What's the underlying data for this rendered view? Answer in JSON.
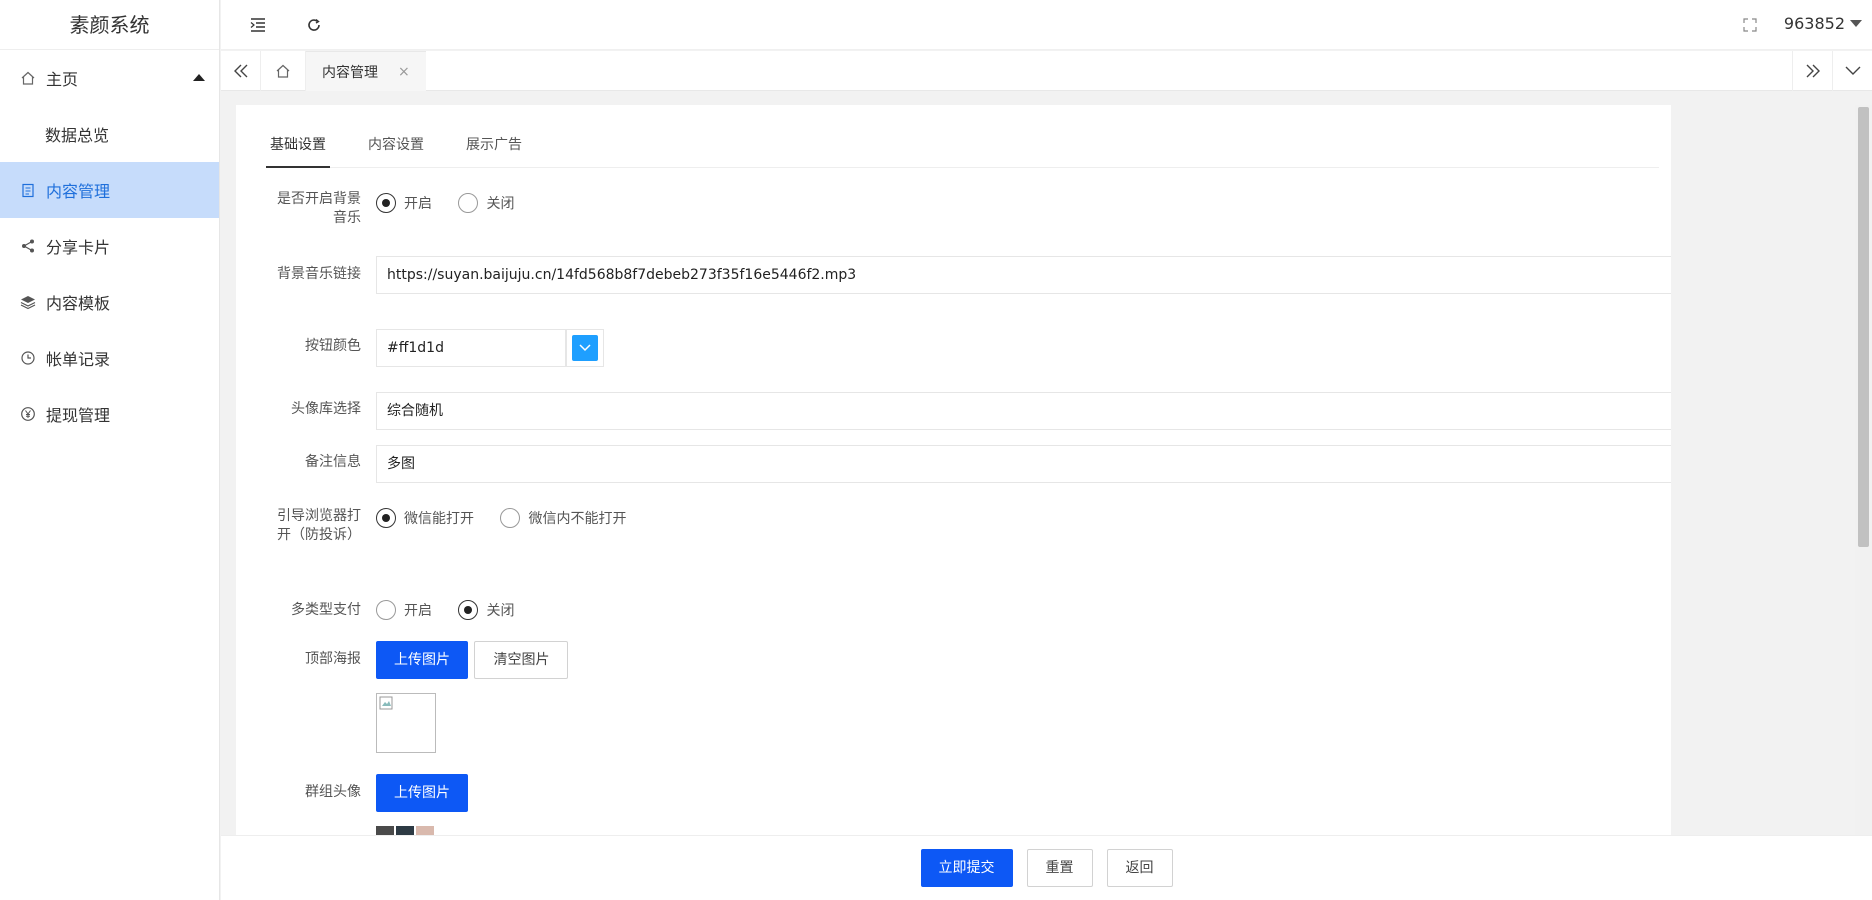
{
  "app": {
    "title": "素颜系统"
  },
  "sidebar": {
    "items": [
      {
        "label": "主页",
        "icon": "home-icon"
      },
      {
        "label": "数据总览"
      },
      {
        "label": "内容管理",
        "icon": "clipboard-icon",
        "active": true
      },
      {
        "label": "分享卡片",
        "icon": "share-icon"
      },
      {
        "label": "内容模板",
        "icon": "layers-icon"
      },
      {
        "label": "帐单记录",
        "icon": "clock-icon"
      },
      {
        "label": "提现管理",
        "icon": "yen-icon"
      }
    ]
  },
  "header": {
    "user": "963852"
  },
  "tabbar": {
    "active_tab": "内容管理",
    "close": "×"
  },
  "form": {
    "tabs": [
      "基础设置",
      "内容设置",
      "展示广告"
    ],
    "bg_music": {
      "label": "是否开启背景音乐",
      "on": "开启",
      "off": "关闭",
      "selected": "on"
    },
    "music_link": {
      "label": "背景音乐链接",
      "value": "https://suyan.baijuju.cn/14fd568b8f7debeb273f35f16e5446f2.mp3"
    },
    "button_color": {
      "label": "按钮颜色",
      "value": "#ff1d1d",
      "swatch": "#1e9fff"
    },
    "avatar_lib": {
      "label": "头像库选择",
      "value": "综合随机"
    },
    "remark": {
      "label": "备注信息",
      "value": "多图"
    },
    "guide_browser": {
      "label": "引导浏览器打开（防投诉）",
      "opt1": "微信能打开",
      "opt2": "微信内不能打开",
      "selected": "opt1"
    },
    "multi_pay": {
      "label": "多类型支付",
      "on": "开启",
      "off": "关闭",
      "selected": "off"
    },
    "top_poster": {
      "label": "顶部海报",
      "upload": "上传图片",
      "clear": "清空图片"
    },
    "group_avatar": {
      "label": "群组头像",
      "upload": "上传图片"
    }
  },
  "footer": {
    "submit": "立即提交",
    "reset": "重置",
    "back": "返回"
  },
  "colors": {
    "primary": "#0d58f5",
    "sidebar_active_bg": "#c6dcfb",
    "sidebar_active_text": "#1e6fdb"
  }
}
